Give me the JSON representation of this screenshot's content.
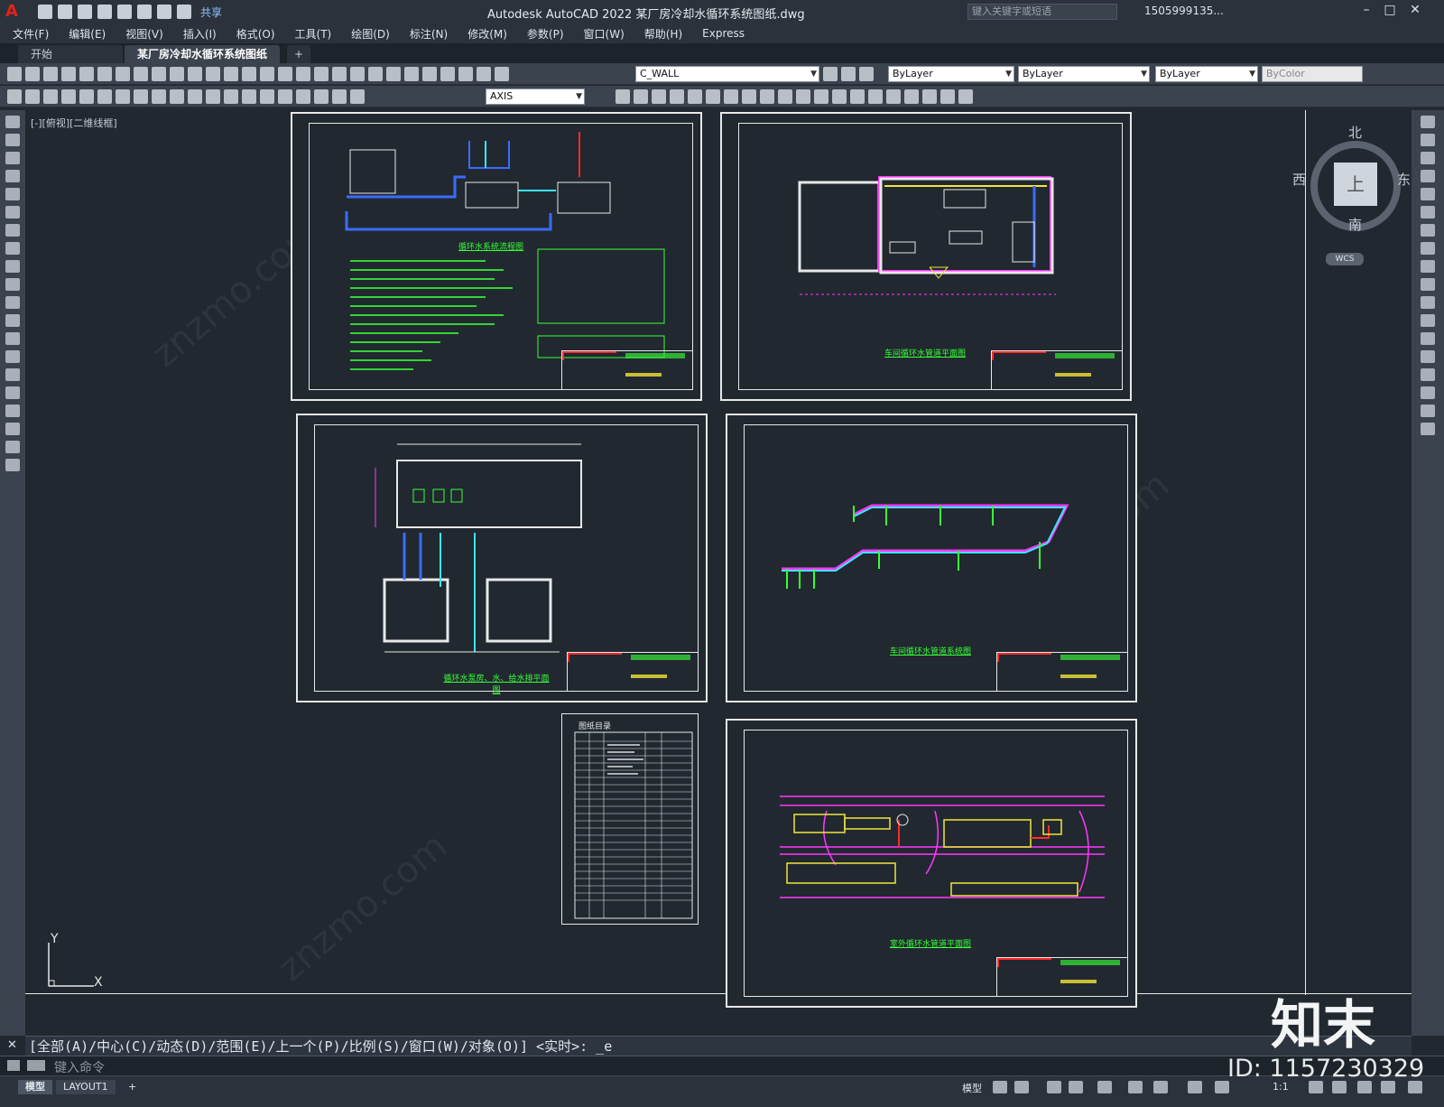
{
  "app": {
    "title": "Autodesk AutoCAD 2022    某厂房冷却水循环系统图纸.dwg",
    "share_label": "共享",
    "search_placeholder": "键入关键字或短语",
    "user": "1505999135...",
    "logo": "A"
  },
  "menu": [
    "文件(F)",
    "编辑(E)",
    "视图(V)",
    "插入(I)",
    "格式(O)",
    "工具(T)",
    "绘图(D)",
    "标注(N)",
    "修改(M)",
    "参数(P)",
    "窗口(W)",
    "帮助(H)",
    "Express"
  ],
  "tabs": [
    {
      "label": "开始"
    },
    {
      "label": "某厂房冷却水循环系统图纸*"
    },
    {
      "label": "+"
    }
  ],
  "toolbar": {
    "layer_name": "C_WALL",
    "color": "ByLayer",
    "linetype": "ByLayer",
    "lineweight": "ByLayer",
    "plotstyle": "ByColor",
    "dimstyle": "AXIS"
  },
  "viewport_label": "[-][俯视][二维线框]",
  "viewcube": {
    "north": "北",
    "south": "南",
    "east": "东",
    "west": "西",
    "top": "上",
    "wcs": "WCS"
  },
  "ucs": {
    "x": "X",
    "y": "Y"
  },
  "command": {
    "history": "[全部(A)/中心(C)/动态(D)/范围(E)/上一个(P)/比例(S)/窗口(W)/对象(O)] <实时>: _e",
    "placeholder": "键入命令",
    "close": "✕"
  },
  "status": {
    "model_tab": "模型",
    "layout_tab": "LAYOUT1",
    "add": "+",
    "model_label": "模型",
    "scale": "1:1"
  },
  "watermark": {
    "brand": "知末",
    "id": "ID: 1157230329",
    "site": "znzmo.com"
  },
  "sheets": [
    {
      "title": "循环水系统流程图"
    },
    {
      "title": "车间循环水管道平面图"
    },
    {
      "title": "循环水泵房、水、给水排平面图"
    },
    {
      "title": "车间循环水管道系统图"
    },
    {
      "title": "图纸目录"
    },
    {
      "title": "室外循环水管道平面图"
    }
  ],
  "colors": {
    "accent": "#38ff38",
    "red": "#ff2a2a",
    "yellow": "#f3e53a",
    "magenta": "#ff37ff",
    "blue": "#3b6bff",
    "cyan": "#38e8ff"
  }
}
